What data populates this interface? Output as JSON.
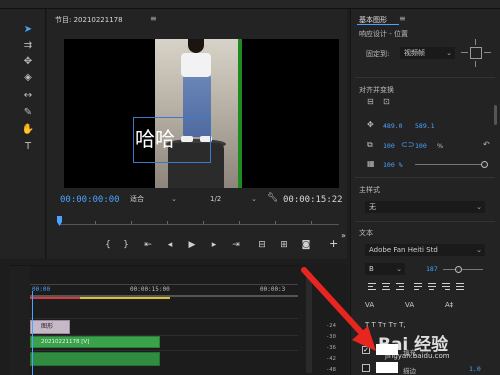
{
  "program_monitor": {
    "title": "节目: 20210221178",
    "menu_icon": "≡",
    "overlay_text": "哈哈",
    "timecode_current": "00:00:00:00",
    "fit_label": "适合",
    "resolution_label": "1/2",
    "timecode_duration": "00:00:15:22"
  },
  "essential_graphics": {
    "title": "基本图形",
    "menu_icon": "≡",
    "subtitle": "响应设计 - 位置",
    "fixed_to_label": "固定到:",
    "fixed_to_value": "视频帧",
    "align_section": "对齐并变换",
    "pos_x": "489.0",
    "pos_y": "589.1",
    "scale_w": "100",
    "scale_h": "100",
    "scale_unit": "%",
    "opacity": "100 %",
    "master_style_label": "主样式",
    "master_style_value": "无",
    "text_section": "文本",
    "font_name": "Adobe Fan Heiti Std",
    "font_style": "B",
    "font_size": "187",
    "fill_label": "填充",
    "stroke_label": "描边",
    "stroke_width": "1.0"
  },
  "timeline": {
    "tc_left": "00:00",
    "tc_mid": "00:00:15:00",
    "tc_right": "00:00:3",
    "clip_graphic_label": "图形",
    "clip_video_label": "20210221178 [V]"
  },
  "meter_values": [
    "-24",
    "-30",
    "-36",
    "-42",
    "-48"
  ],
  "watermark": {
    "brand": "Bai 经验",
    "url": "jingyan.baidu.com"
  },
  "colors": {
    "accent": "#4aa3ff",
    "video_clip": "#3aa24b",
    "graphic_clip": "#c7b8c7",
    "arrow": "#e8261f"
  }
}
